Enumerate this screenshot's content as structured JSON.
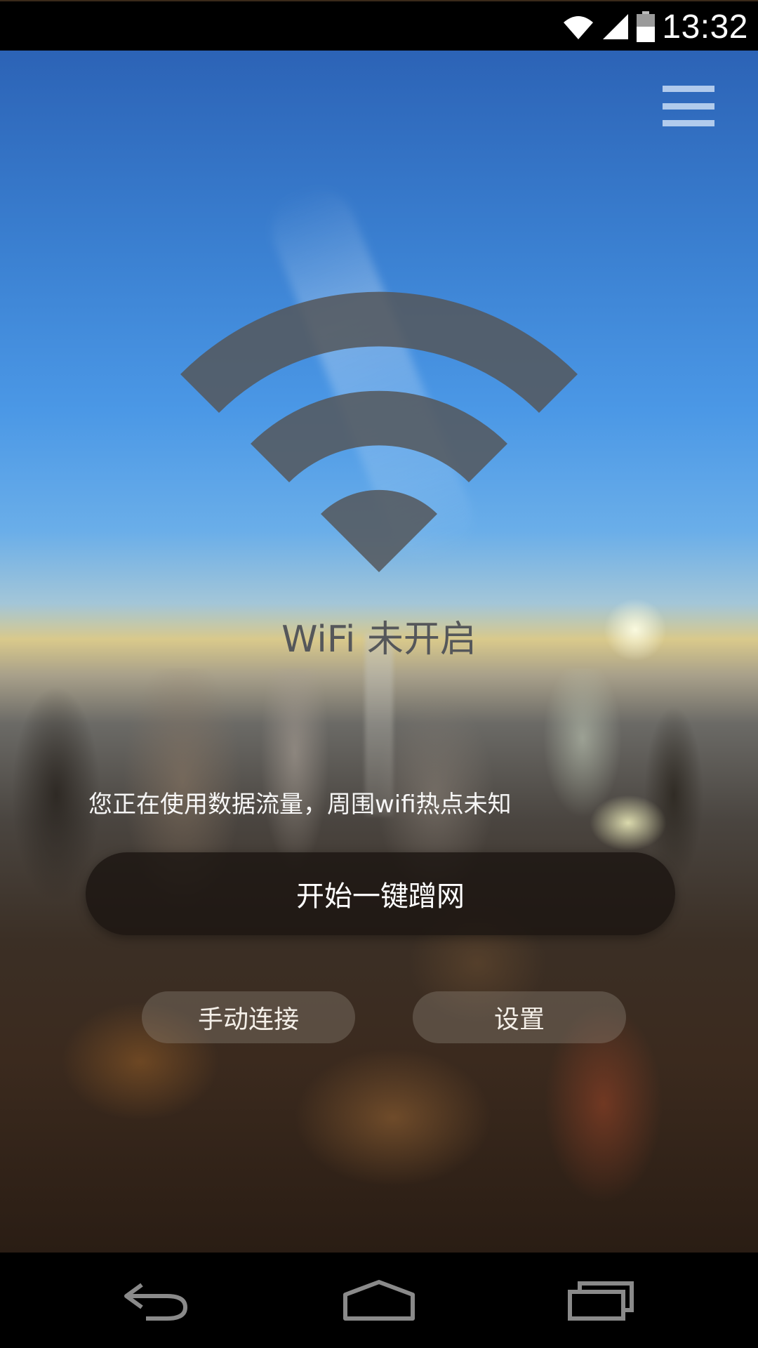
{
  "status_bar": {
    "time": "13:32",
    "icons": [
      "wifi-signal-icon",
      "cell-signal-icon",
      "battery-icon"
    ]
  },
  "header": {
    "menu_icon": "hamburger-menu-icon"
  },
  "main": {
    "wifi_icon": "wifi-icon",
    "status_title": "WiFi 未开启",
    "info_text": "您正在使用数据流量，周围wifi热点未知",
    "primary_button_label": "开始一键蹭网",
    "manual_connect_label": "手动连接",
    "settings_label": "设置"
  },
  "nav_bar": {
    "icons": [
      "back-icon",
      "home-icon",
      "recents-icon"
    ]
  },
  "colors": {
    "wifi_symbol": "#55575a",
    "primary_button_bg": "#1a1410",
    "text_light": "#ffffff"
  }
}
